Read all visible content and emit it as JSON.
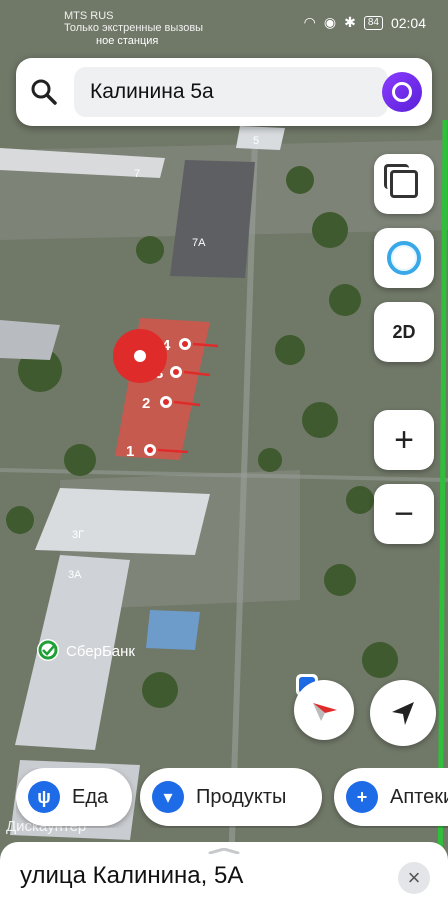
{
  "status_bar": {
    "carrier_line1": "MTS RUS",
    "carrier_line2": "Только экстренные вызовы",
    "battery": "84",
    "time": "02:04"
  },
  "search": {
    "query": "Калинина 5а"
  },
  "map": {
    "building_labels": [
      "5",
      "7",
      "7А",
      "3Г",
      "3А"
    ],
    "entrance_numbers": [
      "4",
      "3",
      "2",
      "1"
    ],
    "poi_name": "СберБанк",
    "poi_bottom_left": "Дискаунтер",
    "poi_top_partial": "ное станция"
  },
  "controls": {
    "mode_2d_label": "2D",
    "zoom_in_label": "+",
    "zoom_out_label": "−"
  },
  "categories": [
    {
      "label": "Еда",
      "icon": "fork-knife-icon"
    },
    {
      "label": "Продукты",
      "icon": "basket-icon"
    },
    {
      "label": "Аптеки",
      "icon": "cross-icon"
    }
  ],
  "sheet": {
    "title": "улица Калинина, 5А"
  },
  "colors": {
    "accent_blue": "#1e6be8",
    "marker_red": "#e02b2b",
    "alice_purple": "#7a33f0"
  }
}
